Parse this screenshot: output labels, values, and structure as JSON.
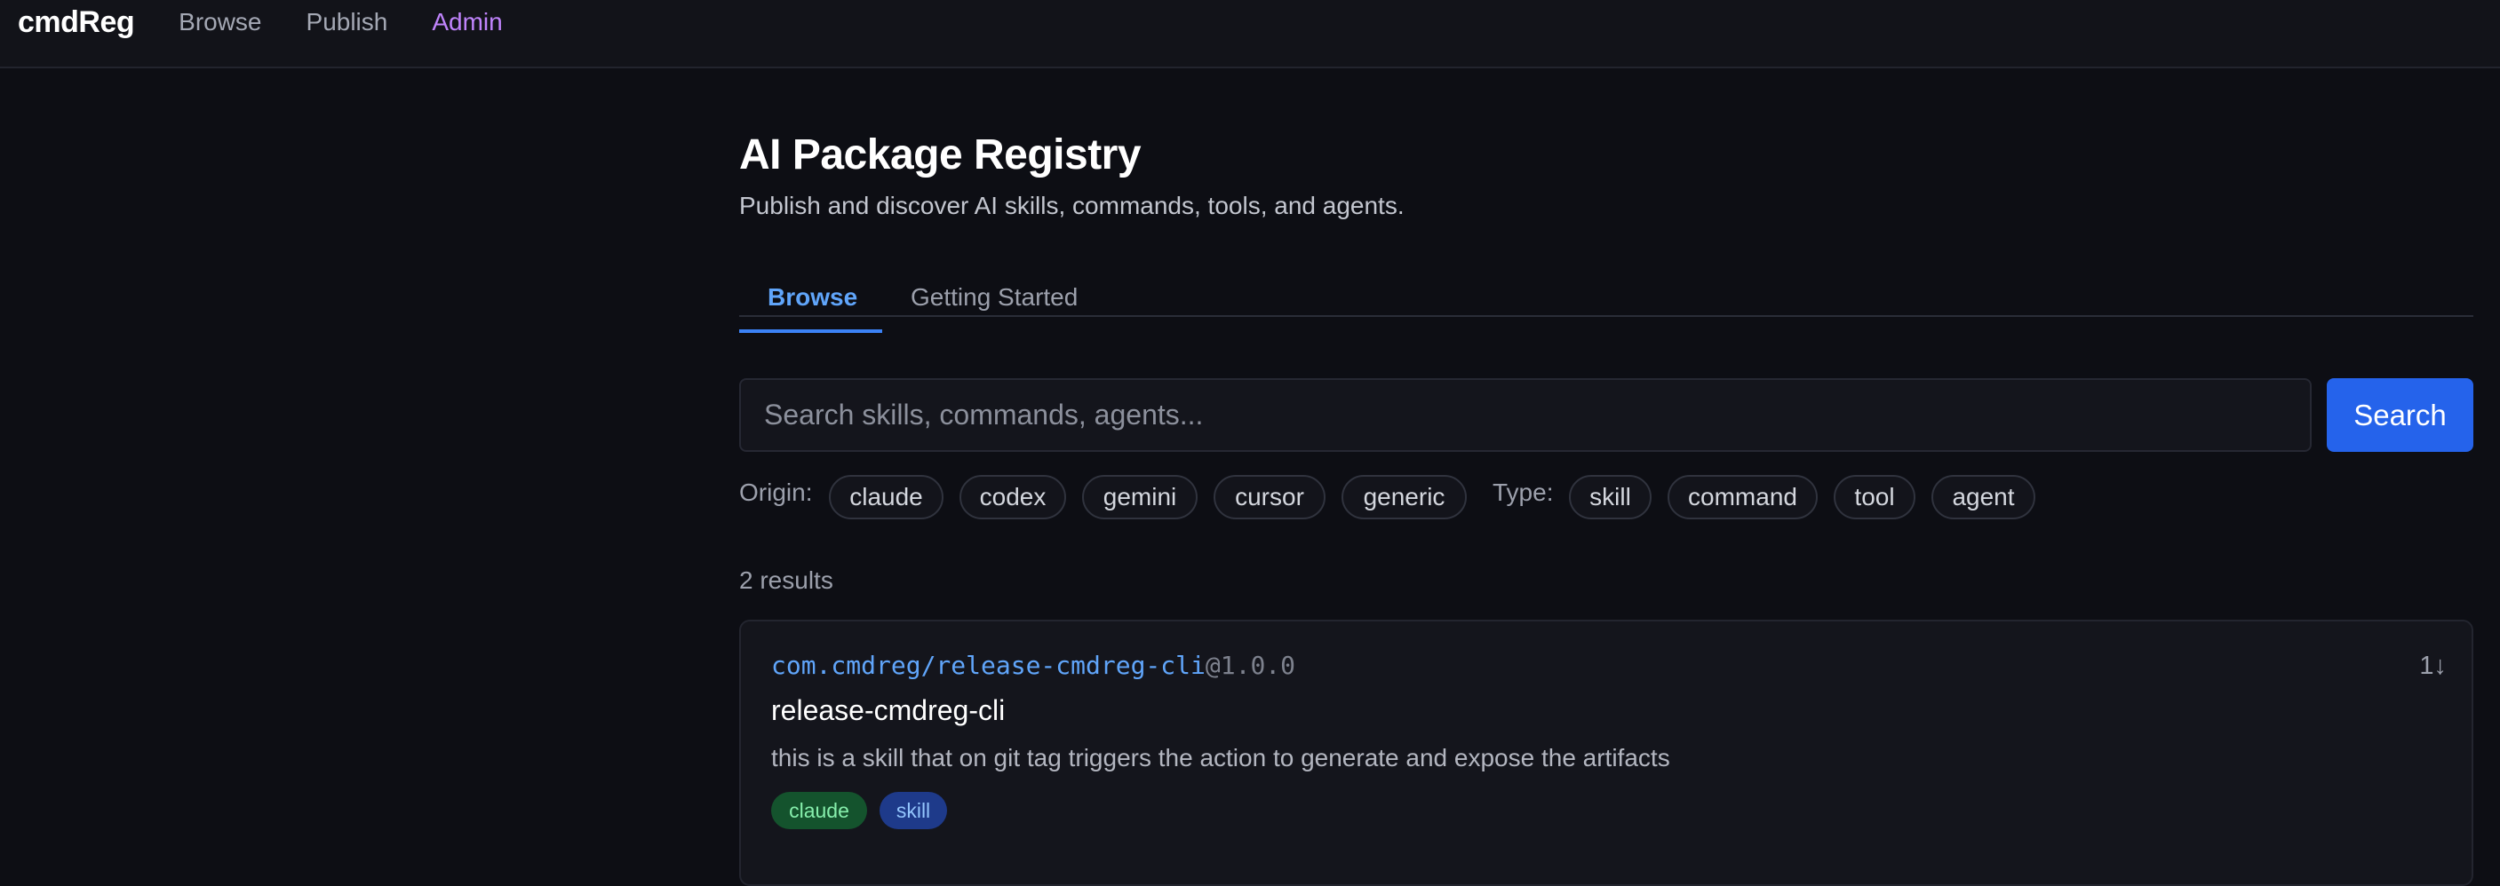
{
  "nav": {
    "brand": "cmdReg",
    "links": [
      "Browse",
      "Publish",
      "Admin"
    ]
  },
  "page": {
    "title": "AI Package Registry",
    "subtitle": "Publish and discover AI skills, commands, tools, and agents."
  },
  "tabs": [
    {
      "label": "Browse",
      "active": true
    },
    {
      "label": "Getting Started",
      "active": false
    }
  ],
  "search": {
    "placeholder": "Search skills, commands, agents...",
    "value": "",
    "button_label": "Search"
  },
  "filters": {
    "origin_label": "Origin:",
    "origins": [
      "claude",
      "codex",
      "gemini",
      "cursor",
      "generic"
    ],
    "type_label": "Type:",
    "types": [
      "skill",
      "command",
      "tool",
      "agent"
    ]
  },
  "results": {
    "count_text": "2 results",
    "items": [
      {
        "ref": "com.cmdreg/release-cmdreg-cli",
        "version": "@1.0.0",
        "name": "release-cmdreg-cli",
        "description": "this is a skill that on git tag triggers the action to generate and expose the artifacts",
        "tags": [
          "claude",
          "skill"
        ],
        "sort_icon": "1↓"
      }
    ]
  },
  "colors": {
    "background": "#0d0e14",
    "accent": "#2563eb",
    "link": "#60a5fa",
    "admin": "#c084fc",
    "origin_tag": "#14532d",
    "type_tag": "#1e3a8a"
  },
  "icons": {
    "sort": "sort-download-icon"
  }
}
